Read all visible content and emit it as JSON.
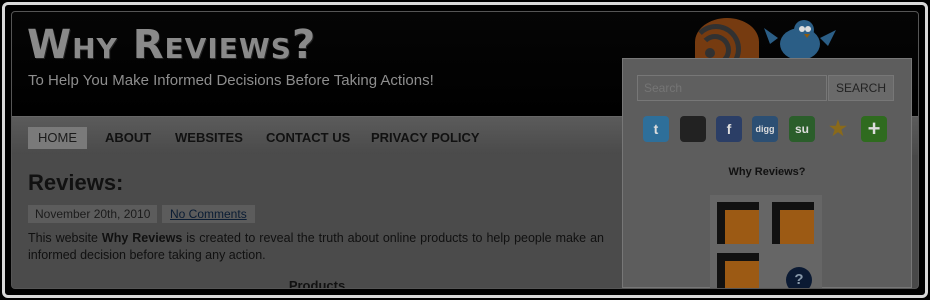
{
  "site": {
    "title": "Why Reviews?",
    "tagline": "To Help You Make Informed Decisions Before Taking Actions!"
  },
  "nav": {
    "items": [
      {
        "label": "HOME",
        "active": true
      },
      {
        "label": "ABOUT"
      },
      {
        "label": "WEBSITES"
      },
      {
        "label": "CONTACT US"
      },
      {
        "label": "PRIVACY POLICY"
      }
    ]
  },
  "post": {
    "title": "Reviews:",
    "date": "November 20th, 2010",
    "comments": "No Comments",
    "body_before": "This website ",
    "body_bold": "Why Reviews",
    "body_after": " is created to reveal the truth about online products to help people make an informed decision before taking any action.",
    "subheading": "Products"
  },
  "sidebar": {
    "search": {
      "placeholder": "Search",
      "button": "SEARCH"
    },
    "social": [
      {
        "icon": "twitter-icon",
        "glyph": "t",
        "color": "#2e6f9a"
      },
      {
        "icon": "delicious-icon",
        "glyph": "",
        "color": "#222222"
      },
      {
        "icon": "facebook-icon",
        "glyph": "f",
        "color": "#2b3e66"
      },
      {
        "icon": "digg-icon",
        "glyph": "digg",
        "color": "#2c4f73"
      },
      {
        "icon": "stumbleupon-icon",
        "glyph": "su",
        "color": "#2b5e2b"
      },
      {
        "icon": "favorite-star-icon",
        "glyph": "★",
        "color": "#8a6a1a"
      },
      {
        "icon": "add-plus-icon",
        "glyph": "+",
        "color": "#2f6b1f"
      }
    ],
    "widget_title": "Why Reviews?"
  }
}
